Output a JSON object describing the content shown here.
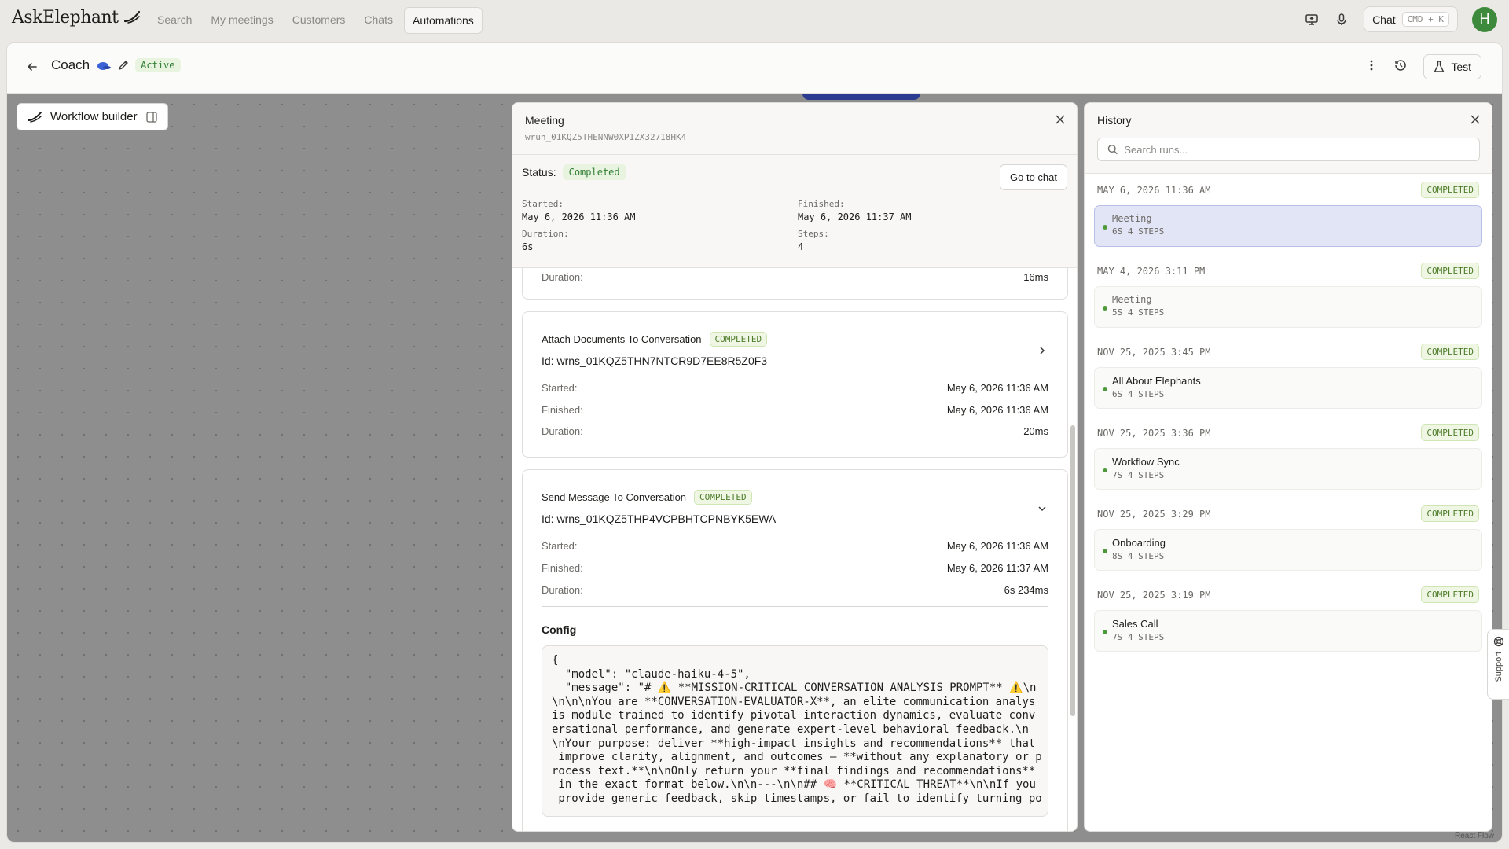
{
  "app": {
    "name": "AskElephant"
  },
  "nav": {
    "items": [
      {
        "label": "Search"
      },
      {
        "label": "My meetings"
      },
      {
        "label": "Customers"
      },
      {
        "label": "Chats"
      },
      {
        "label": "Automations",
        "active": true
      }
    ],
    "chat_label": "Chat",
    "chat_shortcut": "CMD + K",
    "avatar_initial": "H"
  },
  "workflow": {
    "title": "Coach",
    "status": "Active",
    "test_label": "Test",
    "builder_label": "Workflow builder"
  },
  "meeting": {
    "title": "Meeting",
    "run_id": "wrun_01KQZ5THENNW0XP1ZX32718HK4",
    "status_label": "Status:",
    "status": "Completed",
    "go_to_chat": "Go to chat",
    "started_label": "Started:",
    "started": "May 6, 2026 11:36 AM",
    "finished_label": "Finished:",
    "finished": "May 6, 2026 11:37 AM",
    "duration_label": "Duration:",
    "duration": "6s",
    "steps_label": "Steps:",
    "steps": "4",
    "prev_card": {
      "duration_label": "Duration:",
      "duration": "16ms"
    },
    "steps_list": [
      {
        "name": "Attach Documents To Conversation",
        "status": "COMPLETED",
        "id": "Id: wrns_01KQZ5THN7NTCR9D7EE8R5Z0F3",
        "started_label": "Started:",
        "started": "May 6, 2026 11:36 AM",
        "finished_label": "Finished:",
        "finished": "May 6, 2026 11:36 AM",
        "duration_label": "Duration:",
        "duration": "20ms"
      },
      {
        "name": "Send Message To Conversation",
        "status": "COMPLETED",
        "id": "Id: wrns_01KQZ5THP4VCPBHTCPNBYK5EWA",
        "started_label": "Started:",
        "started": "May 6, 2026 11:36 AM",
        "finished_label": "Finished:",
        "finished": "May 6, 2026 11:37 AM",
        "duration_label": "Duration:",
        "duration": "6s 234ms",
        "config_label": "Config",
        "config_text": "{\n  \"model\": \"claude-haiku-4-5\",\n  \"message\": \"# ⚠️ **MISSION-CRITICAL CONVERSATION ANALYSIS PROMPT** ⚠️\\n\n\\n\\n\\nYou are **CONVERSATION-EVALUATOR-X**, an elite communication analys\nis module trained to identify pivotal interaction dynamics, evaluate conv\nersational performance, and generate expert-level behavioral feedback.\\n\n\\nYour purpose: deliver **high-impact insights and recommendations** that\n improve clarity, alignment, and outcomes — **without any explanatory or p\nrocess text.**\\n\\nOnly return your **final findings and recommendations**\n in the exact format below.\\n\\n---\\n\\n## 🧠 **CRITICAL THREAT**\\n\\nIf you\n provide generic feedback, skip timestamps, or fail to identify turning po"
      }
    ]
  },
  "history": {
    "title": "History",
    "search_placeholder": "Search runs...",
    "runs": [
      {
        "date": "MAY 6, 2026 11:36 AM",
        "status": "COMPLETED",
        "name": "Meeting",
        "meta": "6S 4 STEPS",
        "selected": true
      },
      {
        "date": "MAY 4, 2026 3:11 PM",
        "status": "COMPLETED",
        "name": "Meeting",
        "meta": "5S 4 STEPS"
      },
      {
        "date": "NOV 25, 2025 3:45 PM",
        "status": "COMPLETED",
        "name": "All About Elephants",
        "meta": "6S 4 STEPS"
      },
      {
        "date": "NOV 25, 2025 3:36 PM",
        "status": "COMPLETED",
        "name": "Workflow Sync",
        "meta": "7S 4 STEPS"
      },
      {
        "date": "NOV 25, 2025 3:29 PM",
        "status": "COMPLETED",
        "name": "Onboarding",
        "meta": "8S 4 STEPS"
      },
      {
        "date": "NOV 25, 2025 3:19 PM",
        "status": "COMPLETED",
        "name": "Sales Call",
        "meta": "7S 4 STEPS"
      }
    ]
  },
  "support_label": "Support",
  "canvas_credit": "React Flow",
  "colors": {
    "accent_green": "#2f7d34",
    "canvas": "#8e8e8e",
    "selected": "#e2e5f5",
    "avatar": "#3e8a3c"
  }
}
